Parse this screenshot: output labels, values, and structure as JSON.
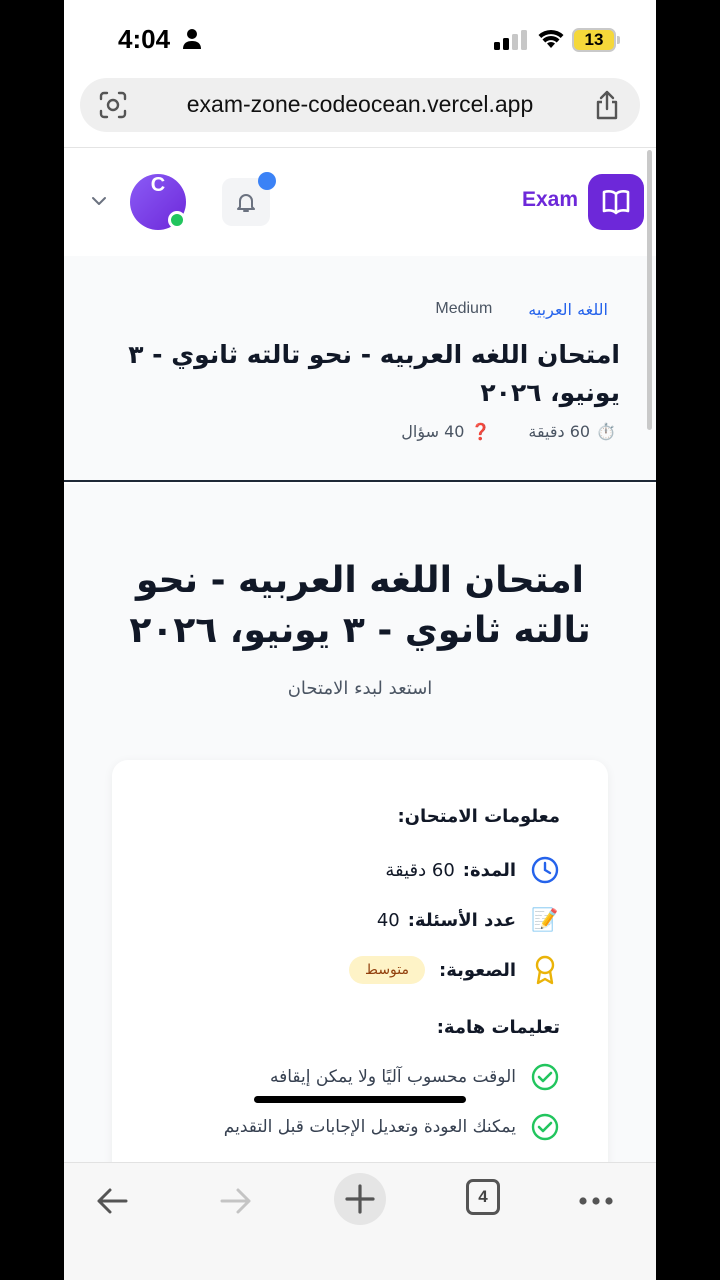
{
  "status_bar": {
    "time": "4:04",
    "battery": "13"
  },
  "browser": {
    "url": "exam-zone-codeocean.vercel.app",
    "tab_count": "4"
  },
  "header": {
    "brand": "Exam",
    "avatar_letter": "C"
  },
  "exam_strip": {
    "subject": "اللغه العربيه",
    "level": "Medium",
    "title": "امتحان اللغه العربيه - نحو تالته ثانوي - ٣ يونيو، ٢٠٢٦",
    "duration": "60 دقيقة",
    "questions": "40 سؤال",
    "duration_icon": "⏱️",
    "questions_icon": "❓"
  },
  "main": {
    "title": "امتحان اللغه العربيه - نحو تالته ثانوي - ٣ يونيو، ٢٠٢٦",
    "subtitle": "استعد لبدء الامتحان"
  },
  "info_card": {
    "section_title": "معلومات الامتحان:",
    "duration_label": "المدة:",
    "duration_value": "60 دقيقة",
    "count_label": "عدد الأسئلة:",
    "count_value": "40",
    "count_icon": "📝",
    "difficulty_label": "الصعوبة:",
    "difficulty_value": "متوسط",
    "instructions_title": "تعليمات هامة:",
    "instructions": [
      "الوقت محسوب آليًا ولا يمكن إيقافه",
      "يمكنك العودة وتعديل الإجابات قبل التقديم"
    ]
  },
  "colors": {
    "brand": "#6d28d9",
    "accent": "#2563eb",
    "success": "#22c55e"
  }
}
